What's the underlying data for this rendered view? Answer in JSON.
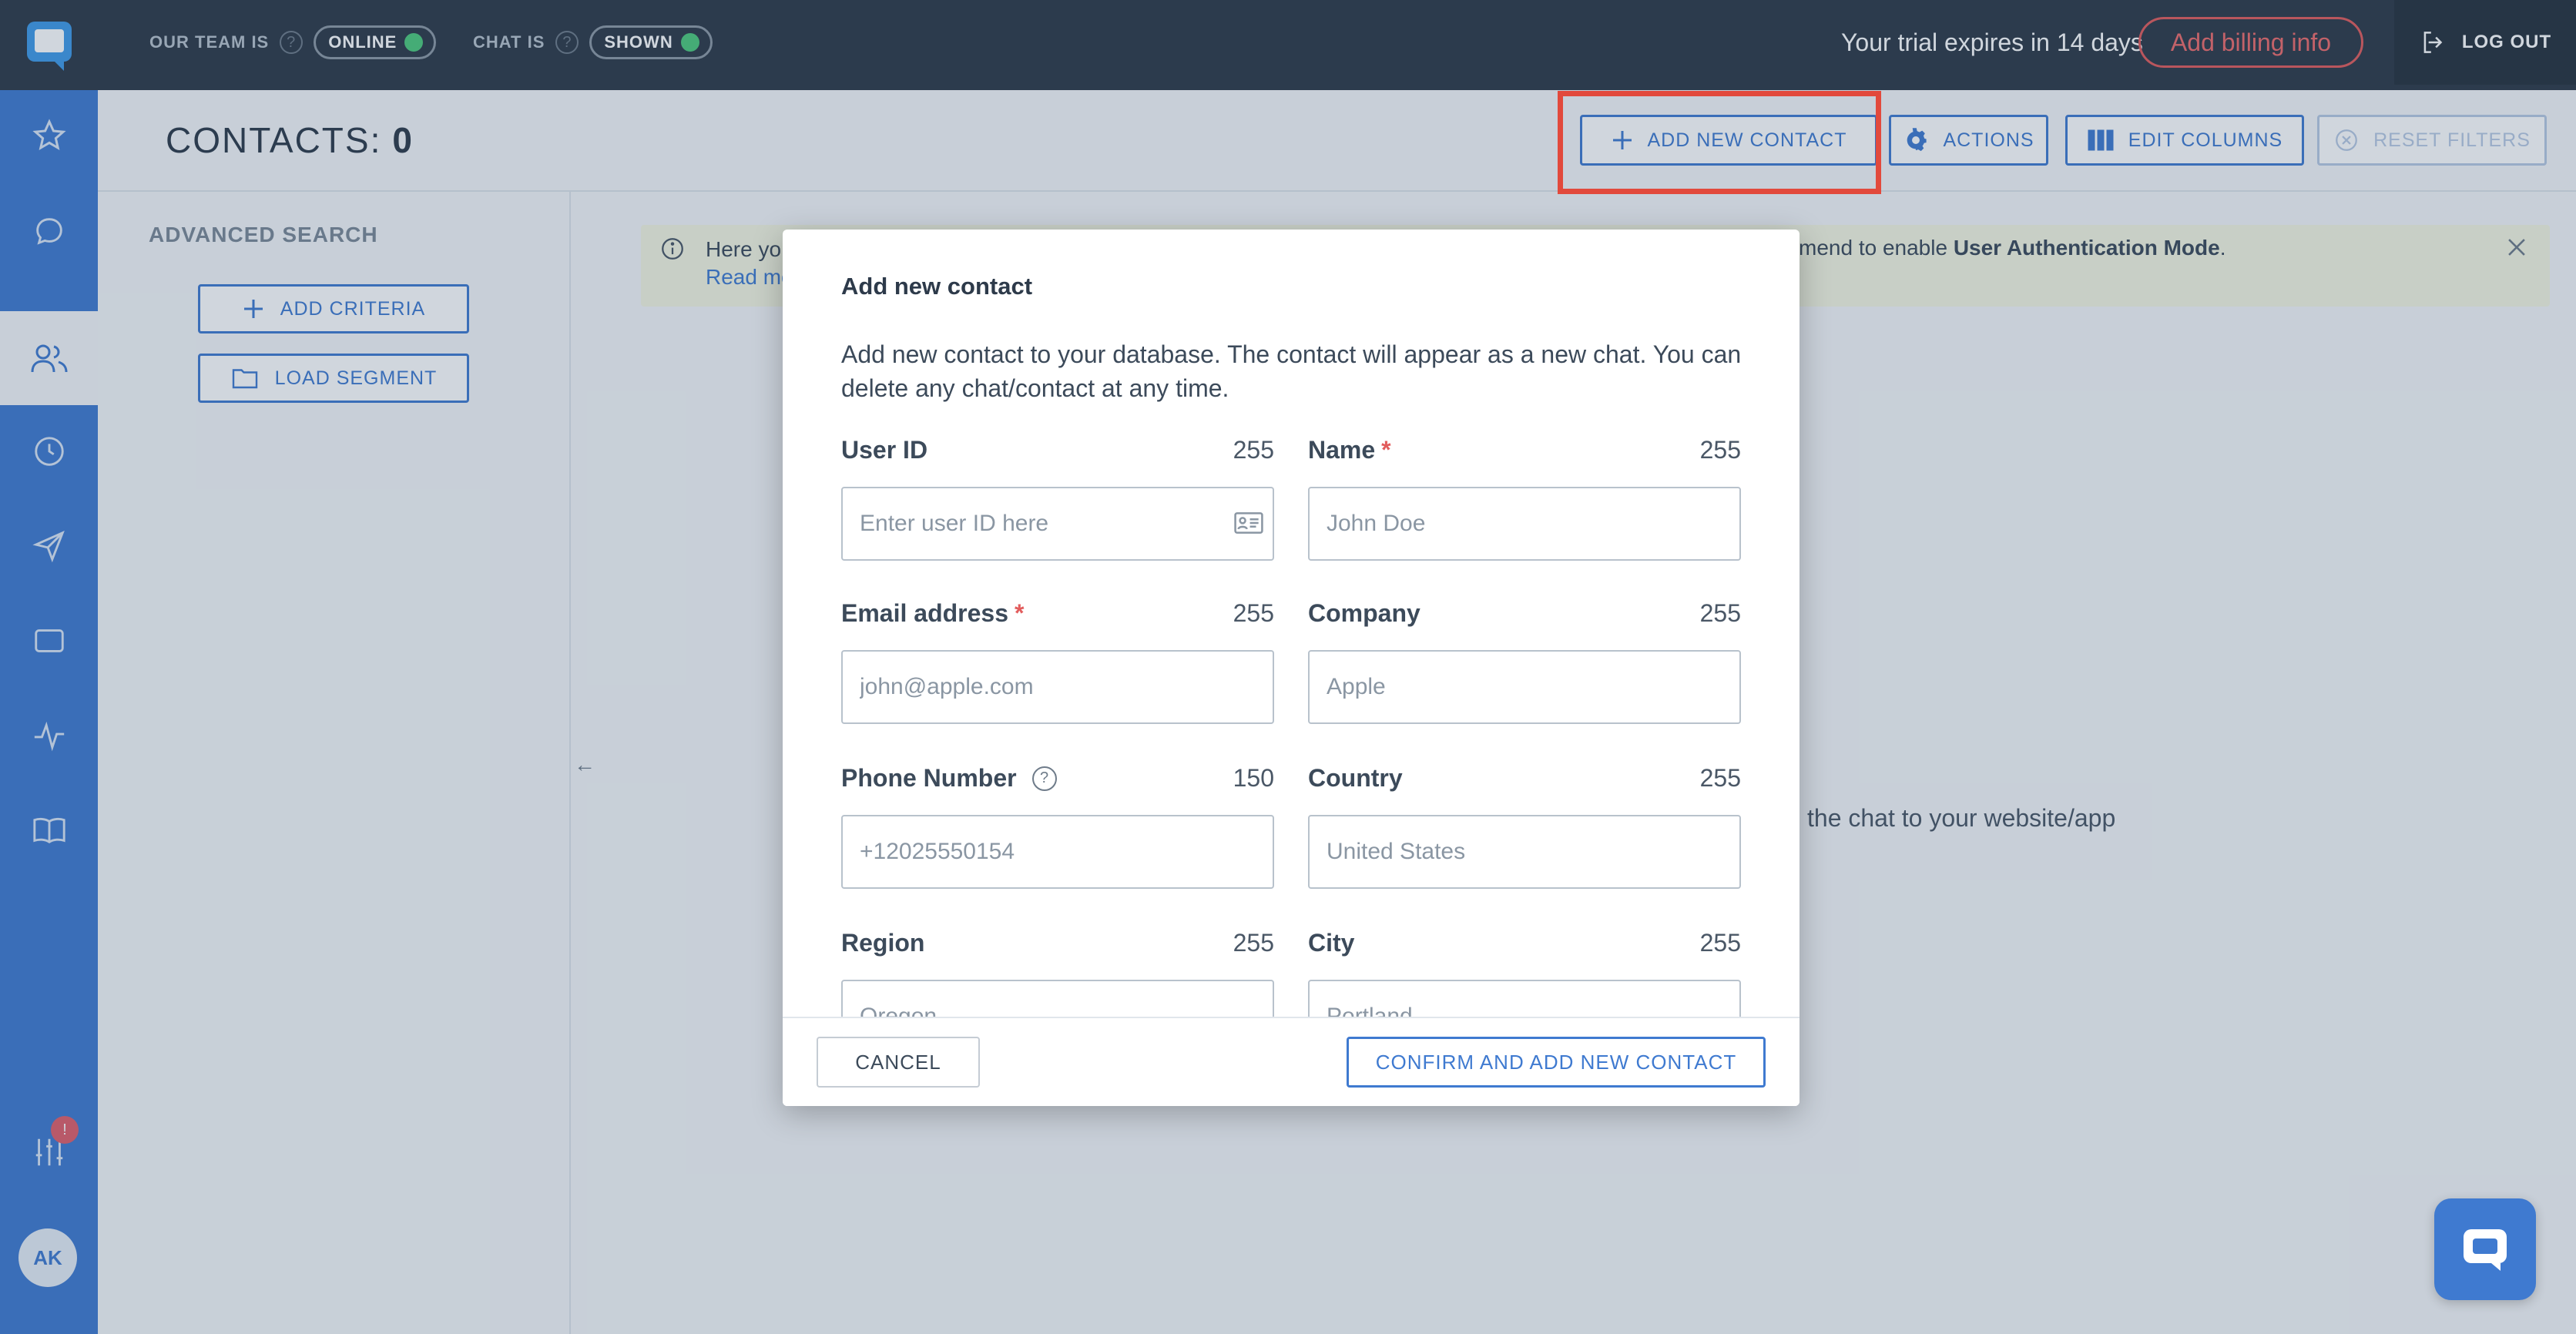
{
  "topbar": {
    "team_label": "OUR TEAM IS",
    "team_status": "ONLINE",
    "chat_label": "CHAT IS",
    "chat_status": "SHOWN",
    "trial_text": "Your trial expires in 14 days",
    "billing_label": "Add billing info",
    "logout_label": "LOG OUT"
  },
  "sidebar": {
    "items": [
      {
        "name": "star-icon",
        "active": false
      },
      {
        "name": "chat-bubble-icon",
        "active": false
      },
      {
        "name": "contacts-icon",
        "active": true
      },
      {
        "name": "clock-icon",
        "active": false
      },
      {
        "name": "send-icon",
        "active": false
      },
      {
        "name": "window-icon",
        "active": false
      },
      {
        "name": "activity-icon",
        "active": false
      },
      {
        "name": "book-icon",
        "active": false
      }
    ],
    "settings_badge": "!",
    "avatar_initials": "AK"
  },
  "header": {
    "title": "CONTACTS:",
    "count": "0",
    "add_contact": "ADD NEW CONTACT",
    "actions": "ACTIONS",
    "edit_columns": "EDIT COLUMNS",
    "reset_filters": "RESET FILTERS"
  },
  "advanced_search": {
    "title": "ADVANCED SEARCH",
    "add_criteria": "ADD CRITERIA",
    "load_segment": "LOAD SEGMENT"
  },
  "banner": {
    "text_start": "Here yo",
    "read_more": "Read mo",
    "text_end_prefix": "mend to enable ",
    "text_end_bold": "User Authentication Mode",
    "text_end_suffix": "."
  },
  "empty_state": "the chat to your website/app",
  "modal": {
    "title": "Add new contact",
    "description": "Add new contact to your database. The contact will appear as a new chat. You can delete any chat/contact at any time.",
    "fields": {
      "user_id": {
        "label": "User ID",
        "count": "255",
        "placeholder": "Enter user ID here"
      },
      "name": {
        "label": "Name",
        "count": "255",
        "placeholder": "John Doe"
      },
      "email": {
        "label": "Email address",
        "count": "255",
        "placeholder": "john@apple.com"
      },
      "company": {
        "label": "Company",
        "count": "255",
        "placeholder": "Apple"
      },
      "phone": {
        "label": "Phone Number",
        "count": "150",
        "placeholder": "+12025550154"
      },
      "country": {
        "label": "Country",
        "count": "255",
        "placeholder": "United States"
      },
      "region": {
        "label": "Region",
        "count": "255",
        "placeholder": "Oregon"
      },
      "city": {
        "label": "City",
        "count": "255",
        "placeholder": "Portland"
      }
    },
    "required_mark": "*",
    "cancel": "CANCEL",
    "confirm": "CONFIRM AND ADD NEW CONTACT"
  },
  "colors": {
    "accent": "#3f7ad0",
    "topbar": "#2d3947",
    "danger": "#e25c5c",
    "online": "#4ec97b"
  }
}
